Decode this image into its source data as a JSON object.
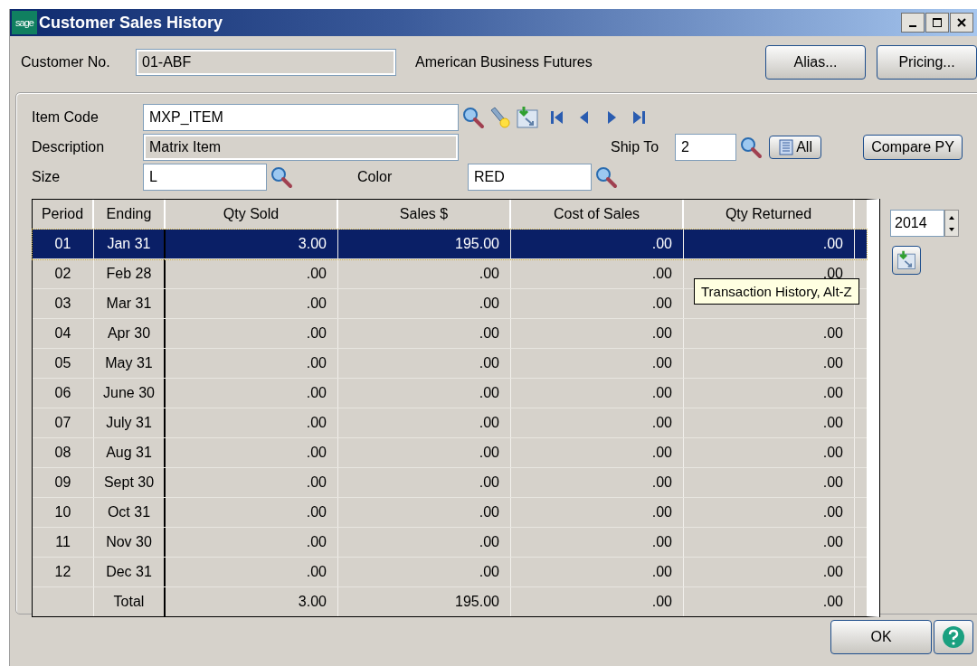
{
  "window": {
    "title": "Customer Sales History",
    "logo": "sage"
  },
  "customer": {
    "label": "Customer No.",
    "value": "01-ABF",
    "name": "American Business Futures"
  },
  "top_buttons": [
    "Alias...",
    "Pricing..."
  ],
  "item_code": {
    "label": "Item Code",
    "value": "MXP_ITEM"
  },
  "description": {
    "label": "Description",
    "value": "Matrix Item"
  },
  "ship_to": {
    "label": "Ship To",
    "value": "2",
    "all_button": "All"
  },
  "compare_button": "Compare PY",
  "size": {
    "label": "Size",
    "value": "L"
  },
  "color": {
    "label": "Color",
    "value": "RED"
  },
  "table": {
    "columns": [
      "Period",
      "Ending",
      "Qty Sold",
      "Sales $",
      "Cost of Sales",
      "Qty Returned"
    ],
    "rows": [
      {
        "period": "01",
        "ending": "Jan 31",
        "qty_sold": "3.00",
        "sales": "195.00",
        "cost": ".00",
        "qty_returned": ".00",
        "selected": true
      },
      {
        "period": "02",
        "ending": "Feb 28",
        "qty_sold": ".00",
        "sales": ".00",
        "cost": ".00",
        "qty_returned": ".00",
        "selected": false
      },
      {
        "period": "03",
        "ending": "Mar 31",
        "qty_sold": ".00",
        "sales": ".00",
        "cost": ".00",
        "selected": false
      },
      {
        "period": "04",
        "ending": "Apr 30",
        "qty_sold": ".00",
        "sales": ".00",
        "cost": ".00",
        "qty_returned": ".00",
        "selected": false
      },
      {
        "period": "05",
        "ending": "May 31",
        "qty_sold": ".00",
        "sales": ".00",
        "cost": ".00",
        "qty_returned": ".00",
        "selected": false
      },
      {
        "period": "06",
        "ending": "June 30",
        "qty_sold": ".00",
        "sales": ".00",
        "cost": ".00",
        "qty_returned": ".00",
        "selected": false
      },
      {
        "period": "07",
        "ending": "July 31",
        "qty_sold": ".00",
        "sales": ".00",
        "cost": ".00",
        "qty_returned": ".00",
        "selected": false
      },
      {
        "period": "08",
        "ending": "Aug 31",
        "qty_sold": ".00",
        "sales": ".00",
        "cost": ".00",
        "qty_returned": ".00",
        "selected": false
      },
      {
        "period": "09",
        "ending": "Sept 30",
        "qty_sold": ".00",
        "sales": ".00",
        "cost": ".00",
        "qty_returned": ".00",
        "selected": false
      },
      {
        "period": "10",
        "ending": "Oct 31",
        "qty_sold": ".00",
        "sales": ".00",
        "cost": ".00",
        "qty_returned": ".00",
        "selected": false
      },
      {
        "period": "11",
        "ending": "Nov 30",
        "qty_sold": ".00",
        "sales": ".00",
        "cost": ".00",
        "qty_returned": ".00",
        "selected": false
      },
      {
        "period": "12",
        "ending": "Dec 31",
        "qty_sold": ".00",
        "sales": ".00",
        "cost": ".00",
        "qty_returned": ".00",
        "selected": false
      }
    ],
    "total": {
      "label": "Total",
      "qty_sold": "3.00",
      "sales": "195.00",
      "cost": ".00",
      "qty_returned": ".00"
    }
  },
  "year": "2014",
  "tooltip": "Transaction History, Alt-Z",
  "ok_button": "OK"
}
